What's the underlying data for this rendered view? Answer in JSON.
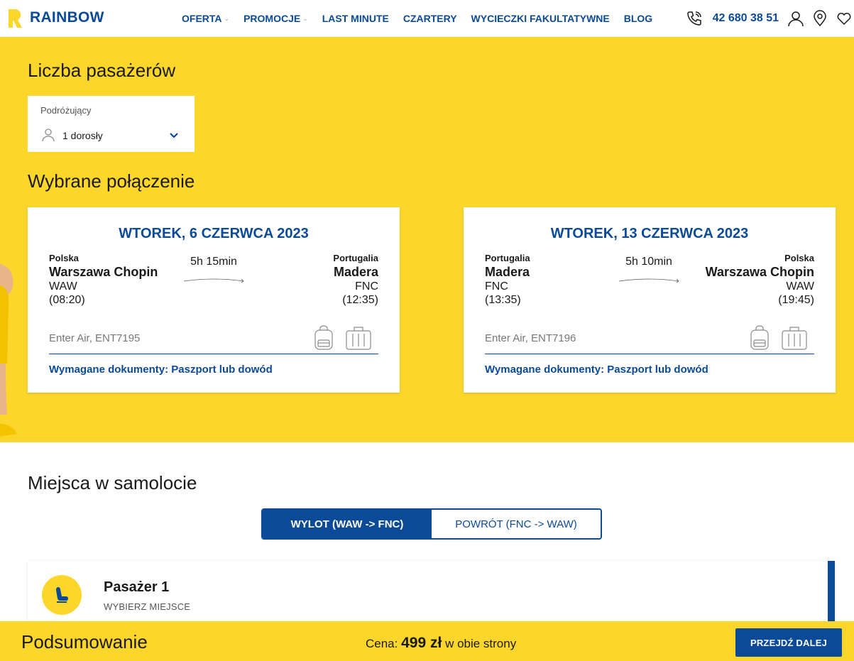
{
  "header": {
    "logo_text": "RAINBOW",
    "nav": [
      {
        "label": "OFERTA",
        "has_dropdown": true
      },
      {
        "label": "PROMOCJE",
        "has_dropdown": true
      },
      {
        "label": "LAST MINUTE",
        "has_dropdown": false
      },
      {
        "label": "CZARTERY",
        "has_dropdown": false
      },
      {
        "label": "WYCIECZKI FAKULTATYWNE",
        "has_dropdown": false
      },
      {
        "label": "BLOG",
        "has_dropdown": false
      }
    ],
    "phone": "42 680 38 51",
    "icons": [
      "phone-icon",
      "user-icon",
      "location-pin-icon",
      "heart-icon"
    ]
  },
  "passengers": {
    "title": "Liczba pasażerów",
    "label": "Podróżujący",
    "value": "1 dorosły"
  },
  "connection": {
    "title": "Wybrane połączenie",
    "flights": [
      {
        "date": "WTOREK, 6 CZERWCA 2023",
        "from": {
          "country": "Polska",
          "city": "Warszawa Chopin",
          "code": "WAW",
          "time": "(08:20)"
        },
        "to": {
          "country": "Portugalia",
          "city": "Madera",
          "code": "FNC",
          "time": "(12:35)"
        },
        "duration": "5h 15min",
        "airline": "Enter Air, ENT7195",
        "documents": "Wymagane dokumenty: Paszport lub dowód"
      },
      {
        "date": "WTOREK, 13 CZERWCA 2023",
        "from": {
          "country": "Portugalia",
          "city": "Madera",
          "code": "FNC",
          "time": "(13:35)"
        },
        "to": {
          "country": "Polska",
          "city": "Warszawa Chopin",
          "code": "WAW",
          "time": "(19:45)"
        },
        "duration": "5h 10min",
        "airline": "Enter Air, ENT7196",
        "documents": "Wymagane dokumenty: Paszport lub dowód"
      }
    ]
  },
  "seats": {
    "title": "Miejsca w samolocie",
    "tabs": [
      {
        "label": "WYLOT (WAW -> FNC)",
        "active": true
      },
      {
        "label": "POWRÓT (FNC -> WAW)",
        "active": false
      }
    ],
    "passenger": {
      "name": "Pasażer 1",
      "action": "WYBIERZ MIEJSCE"
    }
  },
  "footer": {
    "title": "Podsumowanie",
    "price_prefix": "Cena:",
    "price_value": "499 zł",
    "price_suffix": "w obie strony",
    "next_label": "PRZEJDŹ DALEJ"
  },
  "colors": {
    "brand_yellow": "#fdd62b",
    "brand_blue": "#0a4a96"
  }
}
